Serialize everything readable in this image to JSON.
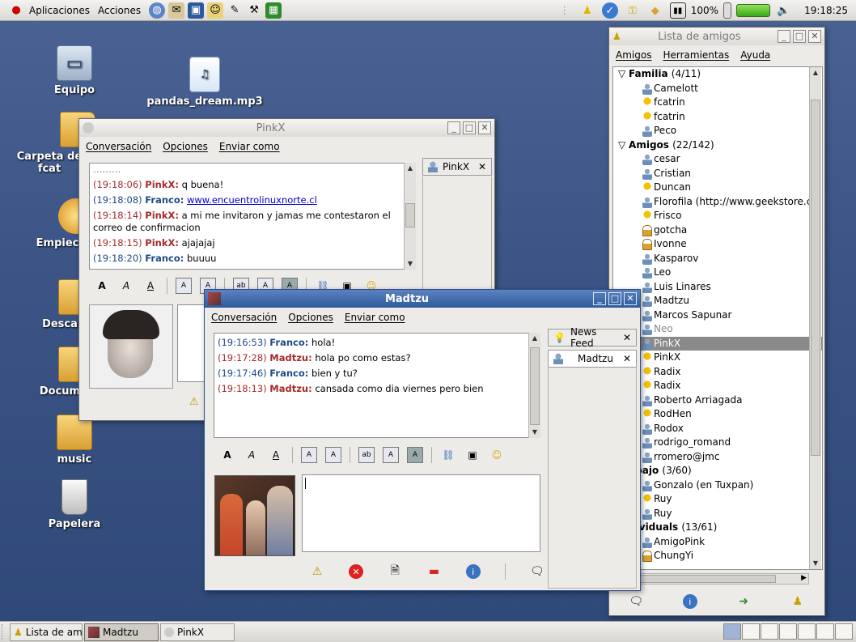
{
  "top_panel": {
    "menu_apps": "Aplicaciones",
    "menu_actions": "Acciones",
    "battery_pct": "100%",
    "clock": "19:18:25"
  },
  "desktop": {
    "icons": [
      {
        "label": "Equipo"
      },
      {
        "label": "pandas_dream.mp3"
      },
      {
        "label": "Carpeta de fcat"
      },
      {
        "label": "Empiec"
      },
      {
        "label": "Desca"
      },
      {
        "label": "Docum"
      },
      {
        "label": "music"
      },
      {
        "label": "Papelera"
      }
    ]
  },
  "pinkx_window": {
    "title": "PinkX",
    "menu": [
      "Conversación",
      "Opciones",
      "Enviar como"
    ],
    "tab_label": "PinkX",
    "messages": [
      {
        "time": "(19:18:06)",
        "name": "PinkX:",
        "text": "q buena!",
        "who": "red"
      },
      {
        "time": "(19:18:08)",
        "name": "Franco:",
        "text": "www.encuentrolinuxnorte.cl",
        "who": "blue",
        "link": true
      },
      {
        "time": "(19:18:14)",
        "name": "PinkX:",
        "text": "a mi me invitaron y jamas me contestaron el correo de confirmacion",
        "who": "red"
      },
      {
        "time": "(19:18:15)",
        "name": "PinkX:",
        "text": "ajajajaj",
        "who": "red"
      },
      {
        "time": "(19:18:20)",
        "name": "Franco:",
        "text": "buuuu",
        "who": "blue"
      }
    ]
  },
  "madtzu_window": {
    "title": "Madtzu",
    "menu": [
      "Conversación",
      "Opciones",
      "Enviar como"
    ],
    "tabs": [
      {
        "label": "News Feed"
      },
      {
        "label": "Madtzu"
      }
    ],
    "messages": [
      {
        "time": "(19:16:53)",
        "name": "Franco:",
        "text": "hola!",
        "who": "blue"
      },
      {
        "time": "(19:17:28)",
        "name": "Madtzu:",
        "text": "hola po como estas?",
        "who": "red"
      },
      {
        "time": "(19:17:46)",
        "name": "Franco:",
        "text": "bien y tu?",
        "who": "blue"
      },
      {
        "time": "(19:18:13)",
        "name": "Madtzu:",
        "text": "cansada como dia viernes pero bien",
        "who": "red"
      }
    ]
  },
  "buddy_window": {
    "title": "Lista de amigos",
    "menu": [
      "Amigos",
      "Herramientas",
      "Ayuda"
    ],
    "rows": [
      {
        "type": "group",
        "name": "Familia",
        "count": "(4/11)"
      },
      {
        "type": "buddy",
        "name": "Camelott",
        "icon": "person"
      },
      {
        "type": "buddy",
        "name": "fcatrin",
        "icon": "bulb"
      },
      {
        "type": "buddy",
        "name": "fcatrin",
        "icon": "bulb"
      },
      {
        "type": "buddy",
        "name": "Peco",
        "icon": "person"
      },
      {
        "type": "group",
        "name": "Amigos",
        "count": "(22/142)"
      },
      {
        "type": "buddy",
        "name": "cesar",
        "icon": "person"
      },
      {
        "type": "buddy",
        "name": "Cristian",
        "icon": "person"
      },
      {
        "type": "buddy",
        "name": "Duncan",
        "icon": "bulb"
      },
      {
        "type": "buddy",
        "name": "Florofila (http://www.geekstore.cl)",
        "icon": "person"
      },
      {
        "type": "buddy",
        "name": "Frisco",
        "icon": "bulb"
      },
      {
        "type": "buddy",
        "name": "gotcha",
        "icon": "lock"
      },
      {
        "type": "buddy",
        "name": "Ivonne",
        "icon": "lock"
      },
      {
        "type": "buddy",
        "name": "Kasparov",
        "icon": "person"
      },
      {
        "type": "buddy",
        "name": "Leo",
        "icon": "person"
      },
      {
        "type": "buddy",
        "name": "Luis Linares",
        "icon": "person"
      },
      {
        "type": "buddy",
        "name": "Madtzu",
        "icon": "person"
      },
      {
        "type": "buddy",
        "name": "Marcos Sapunar",
        "icon": "person"
      },
      {
        "type": "buddy",
        "name": "Neo",
        "icon": "person",
        "idle": true
      },
      {
        "type": "buddy",
        "name": "PinkX",
        "icon": "person",
        "selected": true
      },
      {
        "type": "buddy",
        "name": "PinkX",
        "icon": "bulb"
      },
      {
        "type": "buddy",
        "name": "Radix",
        "icon": "bulb"
      },
      {
        "type": "buddy",
        "name": "Radix",
        "icon": "bulb"
      },
      {
        "type": "buddy",
        "name": "Roberto Arriagada",
        "icon": "person"
      },
      {
        "type": "buddy",
        "name": "RodHen",
        "icon": "bulb"
      },
      {
        "type": "buddy",
        "name": "Rodox",
        "icon": "person"
      },
      {
        "type": "buddy",
        "name": "rodrigo_romand",
        "icon": "person"
      },
      {
        "type": "buddy",
        "name": "rromero@jmc",
        "icon": "person"
      },
      {
        "type": "group",
        "name": "abajo",
        "count": "(3/60)"
      },
      {
        "type": "buddy",
        "name": "Gonzalo (en Tuxpan)",
        "icon": "person"
      },
      {
        "type": "buddy",
        "name": "Ruy",
        "icon": "bulb"
      },
      {
        "type": "buddy",
        "name": "Ruy",
        "icon": "person"
      },
      {
        "type": "group",
        "name": "dividuals",
        "count": "(13/61)"
      },
      {
        "type": "buddy",
        "name": "AmigoPink",
        "icon": "person"
      },
      {
        "type": "buddy",
        "name": "ChungYi",
        "icon": "lock"
      }
    ]
  },
  "taskbar": {
    "tasks": [
      {
        "label": "Lista de ami"
      },
      {
        "label": "Madtzu"
      },
      {
        "label": "PinkX"
      }
    ]
  },
  "colors": {
    "remote": "#a52a2a",
    "local": "#204a87",
    "bulb": "#f2c200",
    "person": "#6b8fb8"
  }
}
